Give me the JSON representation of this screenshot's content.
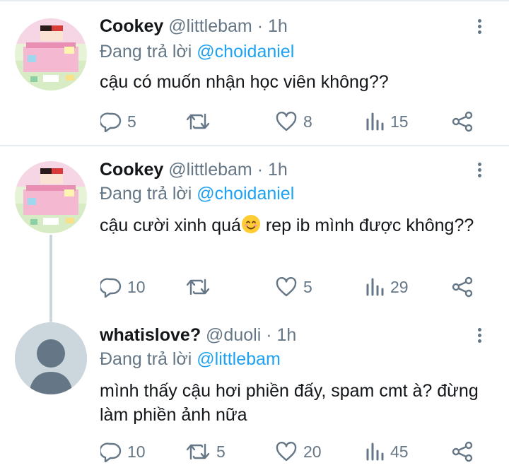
{
  "tweets": [
    {
      "name": "Cookey",
      "handle": "@littlebam",
      "time": "· 1h",
      "reply_prefix": "Đang trả lời",
      "reply_to": "@choidaniel",
      "body": "cậu có muốn nhận học viên không??",
      "replies": "5",
      "retweets": "",
      "likes": "8",
      "views": "15",
      "avatar": "pixel-art-avatar"
    },
    {
      "name": "Cookey",
      "handle": "@littlebam",
      "time": "· 1h",
      "reply_prefix": "Đang trả lời",
      "reply_to": "@choidaniel",
      "body_before_emoji": "cậu cười xinh quá",
      "emoji": "smiling-face-emoji",
      "body_after_emoji": " rep ib mình được không??",
      "replies": "10",
      "retweets": "",
      "likes": "5",
      "views": "29",
      "avatar": "pixel-art-avatar"
    },
    {
      "name": "whatislove?",
      "handle": "@duoli",
      "time": "· 1h",
      "reply_prefix": "Đang trả lời",
      "reply_to": "@littlebam",
      "body": "mình thấy cậu hơi phiền đấy, spam cmt à? đừng làm phiền ảnh nữa",
      "replies": "10",
      "retweets": "5",
      "likes": "20",
      "views": "45",
      "avatar": "default-profile-avatar"
    }
  ],
  "colors": {
    "text": "#14171a",
    "muted": "#657786",
    "accent": "#1da1f2",
    "divider": "#e6ecf0",
    "thread_line": "#ccd6dd",
    "default_avatar_bg": "#ccd6dd",
    "default_avatar_fg": "#657786"
  },
  "icons": [
    "reply-icon",
    "retweet-icon",
    "like-icon",
    "views-icon",
    "share-icon",
    "more-options-icon"
  ]
}
